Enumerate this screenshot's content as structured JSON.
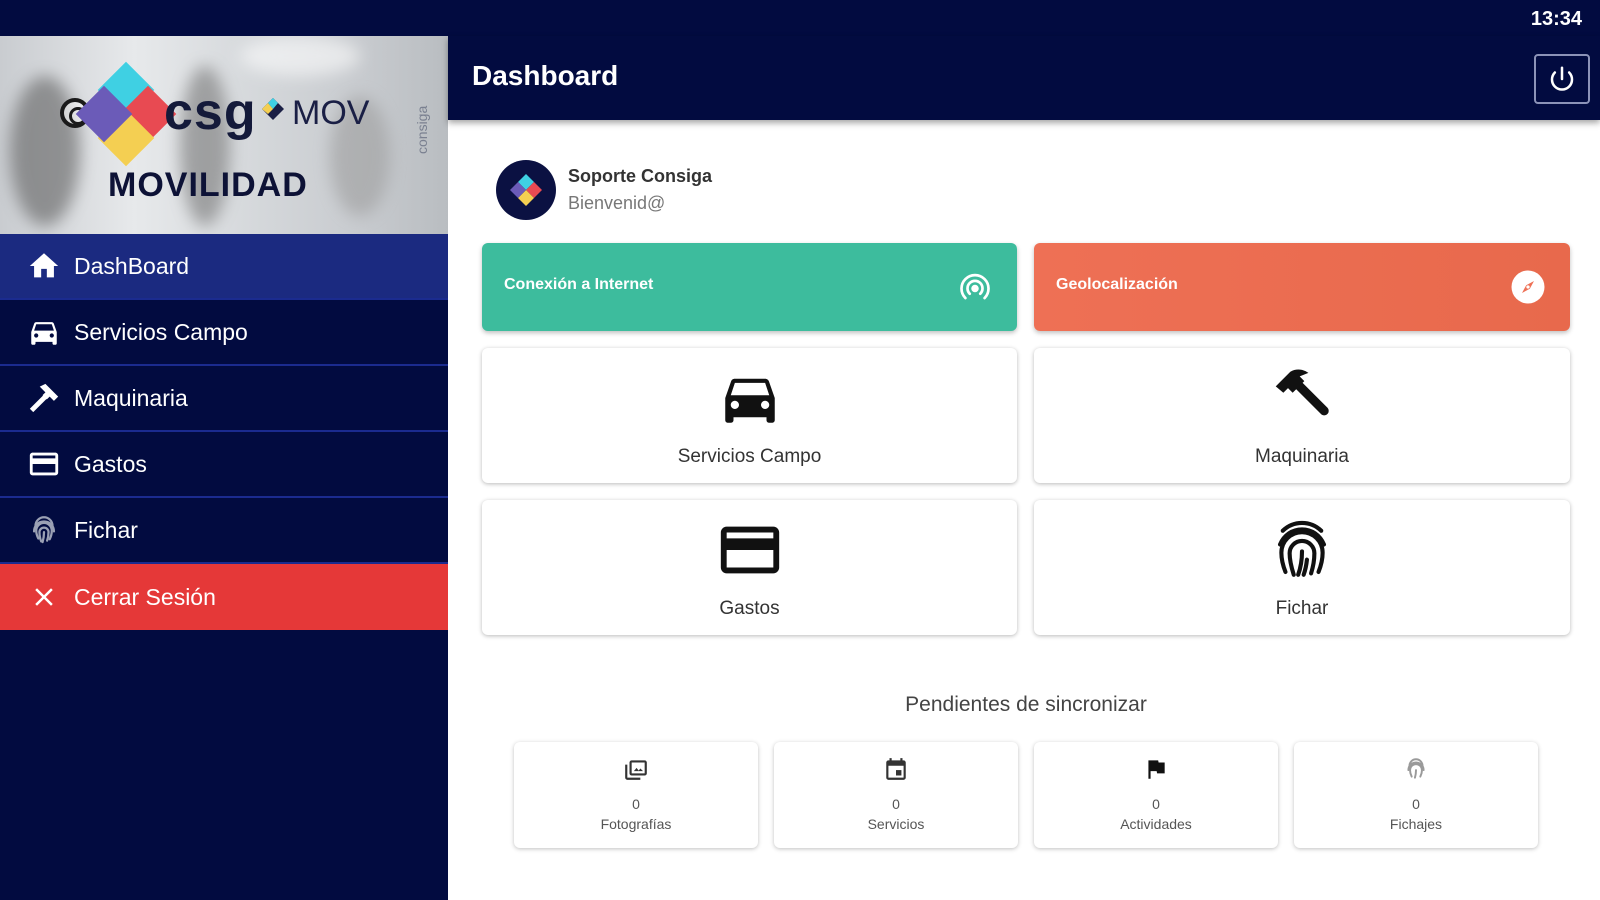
{
  "status_bar": {
    "time": "13:34"
  },
  "brand": {
    "logo_text": "csg",
    "mov_text": "MOV",
    "subtitle": "MOVILIDAD",
    "vertical_text": "consiga"
  },
  "sidebar": {
    "items": [
      {
        "label": "DashBoard",
        "icon": "home-icon",
        "active": true
      },
      {
        "label": "Servicios Campo",
        "icon": "car-icon"
      },
      {
        "label": "Maquinaria",
        "icon": "hammer-icon"
      },
      {
        "label": "Gastos",
        "icon": "credit-card-icon"
      },
      {
        "label": "Fichar",
        "icon": "fingerprint-icon"
      },
      {
        "label": "Cerrar Sesión",
        "icon": "close-icon",
        "color": "#e53838"
      }
    ]
  },
  "header": {
    "title": "Dashboard",
    "power_icon": "power-icon"
  },
  "user": {
    "name": "Soporte Consiga",
    "greeting": "Bienvenid@"
  },
  "status_cards": {
    "internet": {
      "label": "Conexión a Internet",
      "icon": "wifi-tethering-icon",
      "color": "#3dbc9d"
    },
    "geo": {
      "label": "Geolocalización",
      "icon": "compass-icon",
      "color": "#ee7055"
    }
  },
  "tiles": [
    {
      "label": "Servicios Campo",
      "icon": "car-icon"
    },
    {
      "label": "Maquinaria",
      "icon": "hammer-icon"
    },
    {
      "label": "Gastos",
      "icon": "credit-card-icon"
    },
    {
      "label": "Fichar",
      "icon": "fingerprint-icon"
    }
  ],
  "sync": {
    "title": "Pendientes de sincronizar",
    "items": [
      {
        "count": "0",
        "label": "Fotografías",
        "icon": "photo-icon"
      },
      {
        "count": "0",
        "label": "Servicios",
        "icon": "calendar-icon"
      },
      {
        "count": "0",
        "label": "Actividades",
        "icon": "flag-icon"
      },
      {
        "count": "0",
        "label": "Fichajes",
        "icon": "fingerprint-icon"
      }
    ]
  },
  "colors": {
    "navy": "#020b40",
    "active_item": "#1b2a80",
    "logout": "#e53838",
    "teal": "#3dbc9d",
    "coral": "#ee7055"
  }
}
